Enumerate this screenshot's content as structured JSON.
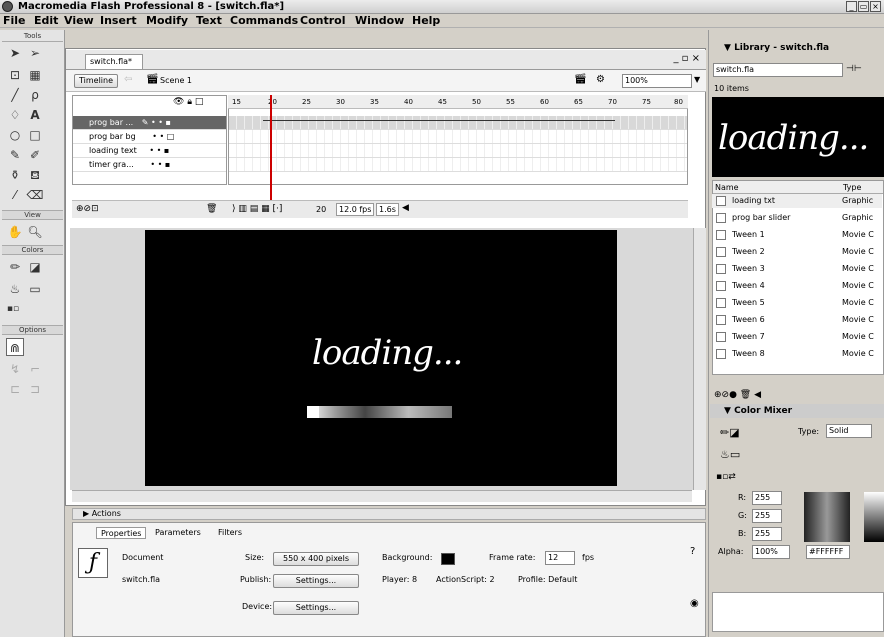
{
  "window": {
    "title": "Macromedia Flash Professional 8 - [switch.fla*]"
  },
  "menu": [
    "File",
    "Edit",
    "View",
    "Insert",
    "Modify",
    "Text",
    "Commands",
    "Control",
    "Window",
    "Help"
  ],
  "tools": {
    "header": "Tools",
    "view_label": "View",
    "colors_label": "Colors",
    "options_label": "Options"
  },
  "document": {
    "tab": "switch.fla*",
    "timeline_button": "Timeline",
    "scene": "Scene 1",
    "zoom": "100%"
  },
  "timeline": {
    "layers": [
      {
        "name": "prog bar ...",
        "selected": true
      },
      {
        "name": "prog bar bg",
        "selected": false
      },
      {
        "name": "loading text",
        "selected": false
      },
      {
        "name": "timer gra...",
        "selected": false
      }
    ],
    "ruler": [
      "15",
      "20",
      "25",
      "30",
      "35",
      "40",
      "45",
      "50",
      "55",
      "60",
      "65",
      "70",
      "75",
      "80"
    ],
    "current_frame": "20",
    "fps": "12.0 fps",
    "elapsed": "1.6s"
  },
  "stage": {
    "text": "loading...",
    "progress": 0.1
  },
  "actions_label": "Actions",
  "properties": {
    "tabs": [
      "Properties",
      "Parameters",
      "Filters"
    ],
    "doc_label": "Document",
    "file": "switch.fla",
    "size_label": "Size:",
    "size_value": "550 x 400 pixels",
    "background_label": "Background:",
    "framerate_label": "Frame rate:",
    "framerate": "12",
    "fps_unit": "fps",
    "publish_label": "Publish:",
    "settings_button": "Settings...",
    "player": "Player: 8",
    "actionscript": "ActionScript: 2",
    "profile": "Profile: Default",
    "device_label": "Device:",
    "device_button": "Settings..."
  },
  "library": {
    "title": "Library - switch.fla",
    "file": "switch.fla",
    "count": "10 items",
    "preview_text": "loading...",
    "col_name": "Name",
    "col_type": "Type",
    "items": [
      {
        "name": "loading txt",
        "type": "Graphic"
      },
      {
        "name": "prog bar slider",
        "type": "Graphic"
      },
      {
        "name": "Tween 1",
        "type": "Movie C"
      },
      {
        "name": "Tween 2",
        "type": "Movie C"
      },
      {
        "name": "Tween 3",
        "type": "Movie C"
      },
      {
        "name": "Tween 4",
        "type": "Movie C"
      },
      {
        "name": "Tween 5",
        "type": "Movie C"
      },
      {
        "name": "Tween 6",
        "type": "Movie C"
      },
      {
        "name": "Tween 7",
        "type": "Movie C"
      },
      {
        "name": "Tween 8",
        "type": "Movie C"
      }
    ]
  },
  "color_mixer": {
    "title": "Color Mixer",
    "type_label": "Type:",
    "type_value": "Solid",
    "r_label": "R:",
    "r": "255",
    "g_label": "G:",
    "g": "255",
    "b_label": "B:",
    "b": "255",
    "alpha_label": "Alpha:",
    "alpha": "100%",
    "hex": "#FFFFFF"
  }
}
